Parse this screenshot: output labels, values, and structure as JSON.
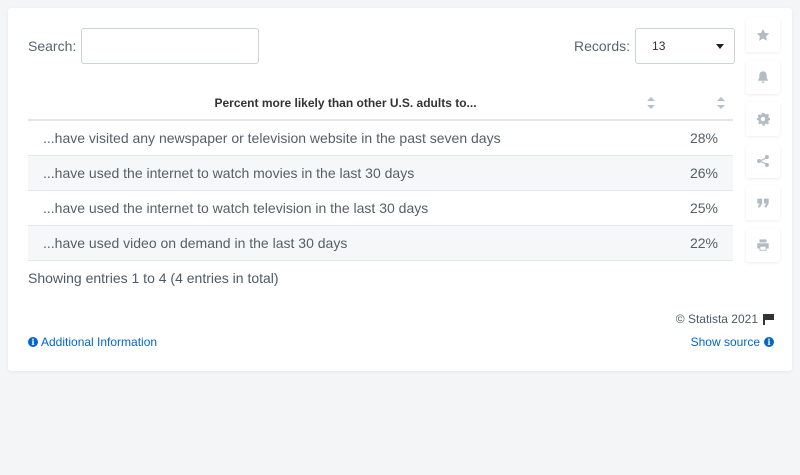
{
  "search": {
    "label": "Search:",
    "value": "",
    "placeholder": ""
  },
  "records": {
    "label": "Records:",
    "selected": "13"
  },
  "table": {
    "headers": [
      "Percent more likely than other U.S. adults to...",
      ""
    ],
    "rows": [
      {
        "label": "...have visited any newspaper or television website in the past seven days",
        "value": "28%"
      },
      {
        "label": "...have used the internet to watch movies in the last 30 days",
        "value": "26%"
      },
      {
        "label": "...have used the internet to watch television in the last 30 days",
        "value": "25%"
      },
      {
        "label": "...have used video on demand in the last 30 days",
        "value": "22%"
      }
    ]
  },
  "footer": {
    "showing": "Showing entries 1 to 4 (4 entries in total)",
    "copyright": "© Statista 2021",
    "additional_info": "Additional Information",
    "show_source": "Show source"
  },
  "toolbar": {
    "icons": [
      "star-icon",
      "bell-icon",
      "gear-icon",
      "share-icon",
      "quote-icon",
      "print-icon"
    ]
  },
  "colors": {
    "link": "#0066cc",
    "row_alt": "#f5f7f9",
    "icon": "#b3bcc4"
  },
  "chart_data": {
    "type": "table",
    "columns": [
      "Percent more likely than other U.S. adults to...",
      ""
    ],
    "categories": [
      "...have visited any newspaper or television website in the past seven days",
      "...have used the internet to watch movies in the last 30 days",
      "...have used the internet to watch television in the last 30 days",
      "...have used video on demand in the last 30 days"
    ],
    "values": [
      28,
      26,
      25,
      22
    ],
    "unit": "%"
  }
}
